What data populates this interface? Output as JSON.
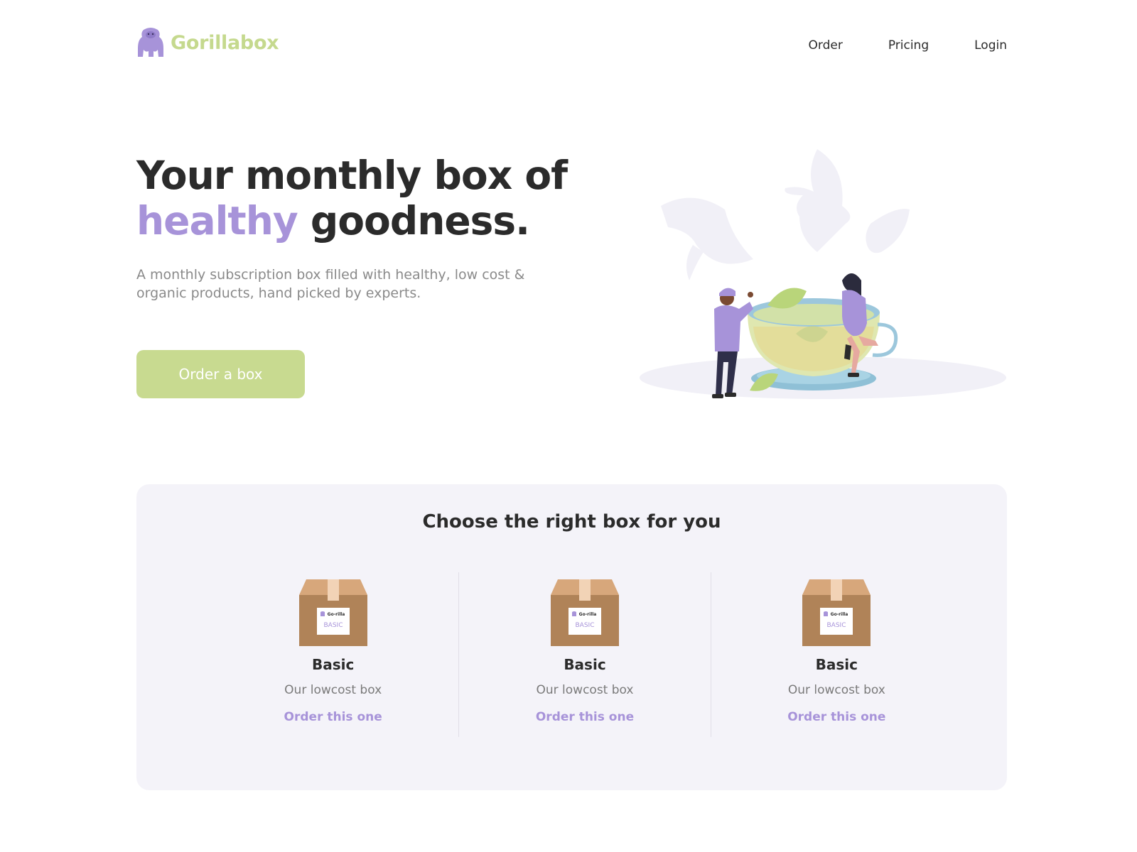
{
  "brand": {
    "name": "Gorillabox",
    "logo_icon": "gorilla-icon",
    "color": "#c5d98e",
    "icon_color": "#a793d9"
  },
  "nav": {
    "items": [
      {
        "label": "Order"
      },
      {
        "label": "Pricing"
      },
      {
        "label": "Login"
      }
    ]
  },
  "hero": {
    "title_line1": "Your monthly box of",
    "title_accent": "healthy",
    "title_rest": "goodness.",
    "subtitle": "A monthly subscription box filled with healthy, low cost & organic products, hand picked by experts.",
    "cta_label": "Order a box",
    "illustration": "tea-cup-illustration"
  },
  "boxes": {
    "title": "Choose the right box for you",
    "items": [
      {
        "name": "Basic",
        "description": "Our lowcost box",
        "link_label": "Order this one",
        "box_brand": "Go-rilla",
        "box_tier": "BASIC"
      },
      {
        "name": "Basic",
        "description": "Our lowcost box",
        "link_label": "Order this one",
        "box_brand": "Go-rilla",
        "box_tier": "BASIC"
      },
      {
        "name": "Basic",
        "description": "Our lowcost box",
        "link_label": "Order this one",
        "box_brand": "Go-rilla",
        "box_tier": "BASIC"
      }
    ]
  },
  "colors": {
    "accent_purple": "#a793d9",
    "accent_green": "#c8da90",
    "section_bg": "#f4f3f9",
    "text_dark": "#2b2b2b",
    "text_muted": "#8a8a8a"
  }
}
